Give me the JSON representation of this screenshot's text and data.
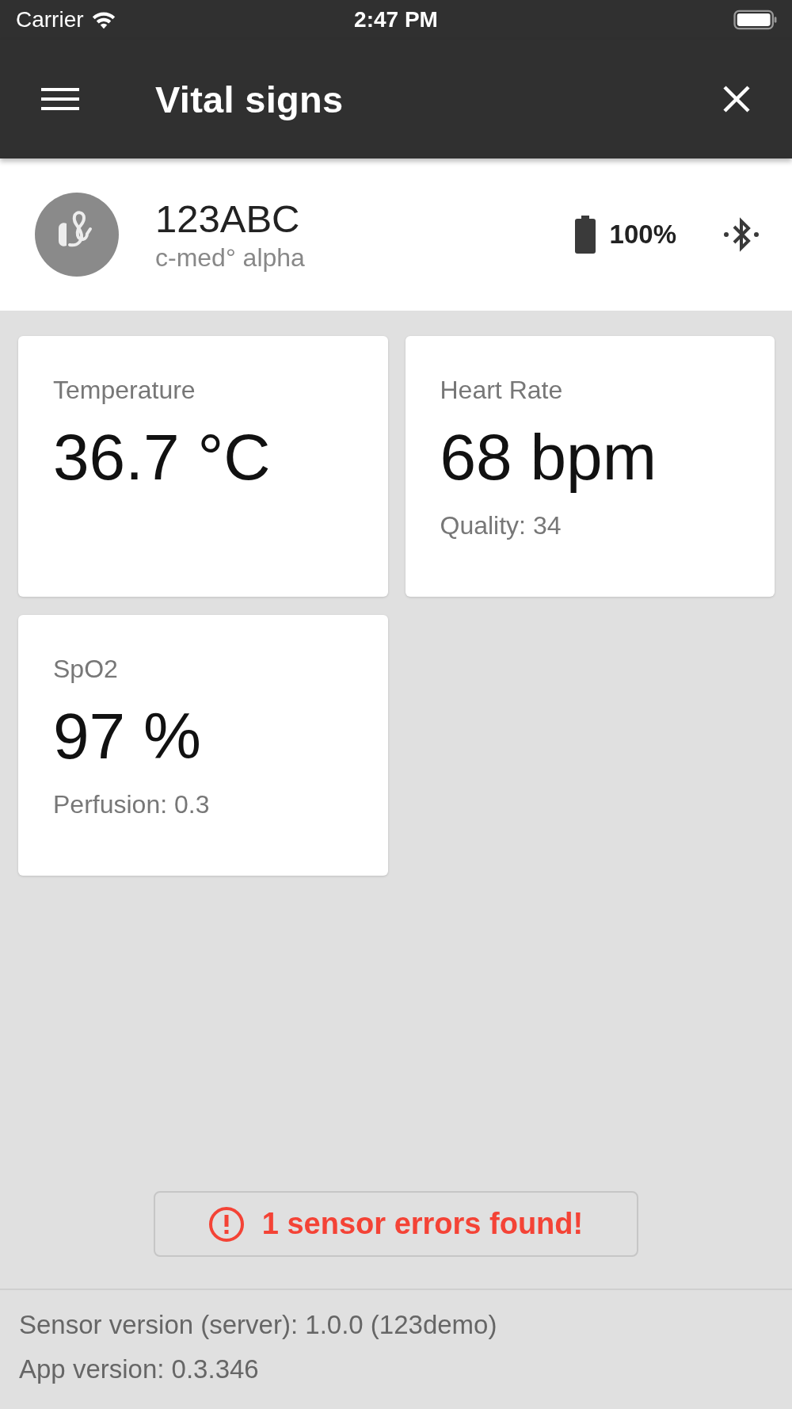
{
  "status_bar": {
    "carrier": "Carrier",
    "time": "2:47 PM"
  },
  "app_bar": {
    "title": "Vital signs"
  },
  "device": {
    "name": "123ABC",
    "model": "c-med° alpha",
    "battery": "100%"
  },
  "cards": [
    {
      "label": "Temperature",
      "value": "36.7 °C"
    },
    {
      "label": "Heart Rate",
      "value": "68 bpm",
      "detail": "Quality: 34"
    },
    {
      "label": "SpO2",
      "value": "97 %",
      "detail": "Perfusion: 0.3"
    }
  ],
  "error_button": {
    "label": "1 sensor errors found!"
  },
  "footer": [
    "Sensor version (server): 1.0.0 (123demo)",
    "App version: 0.3.346"
  ]
}
